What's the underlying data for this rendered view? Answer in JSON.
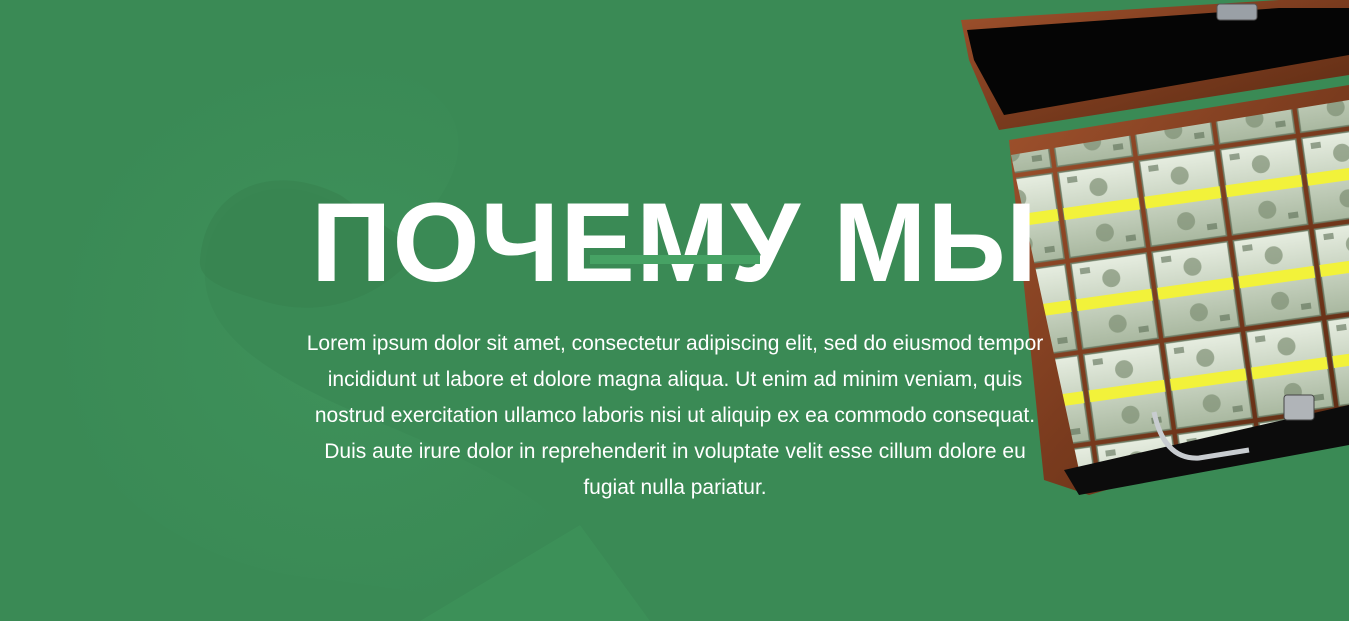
{
  "hero": {
    "title": "ПОЧЕМУ МЫ",
    "body": "Lorem ipsum dolor sit amet, consectetur adipiscing elit, sed do eiusmod tempor incididunt ut labore et dolore magna aliqua. Ut enim ad minim veniam, quis nostrud exercitation ullamco laboris nisi ut aliquip ex ea commodo consequat. Duis aute irure dolor in reprehenderit in voluptate velit esse cillum dolore eu fugiat nulla pariatur."
  },
  "colors": {
    "background": "#3a8a55",
    "accent": "#46a264",
    "text": "#ffffff"
  },
  "images": {
    "briefcase": "briefcase-of-money-image"
  }
}
